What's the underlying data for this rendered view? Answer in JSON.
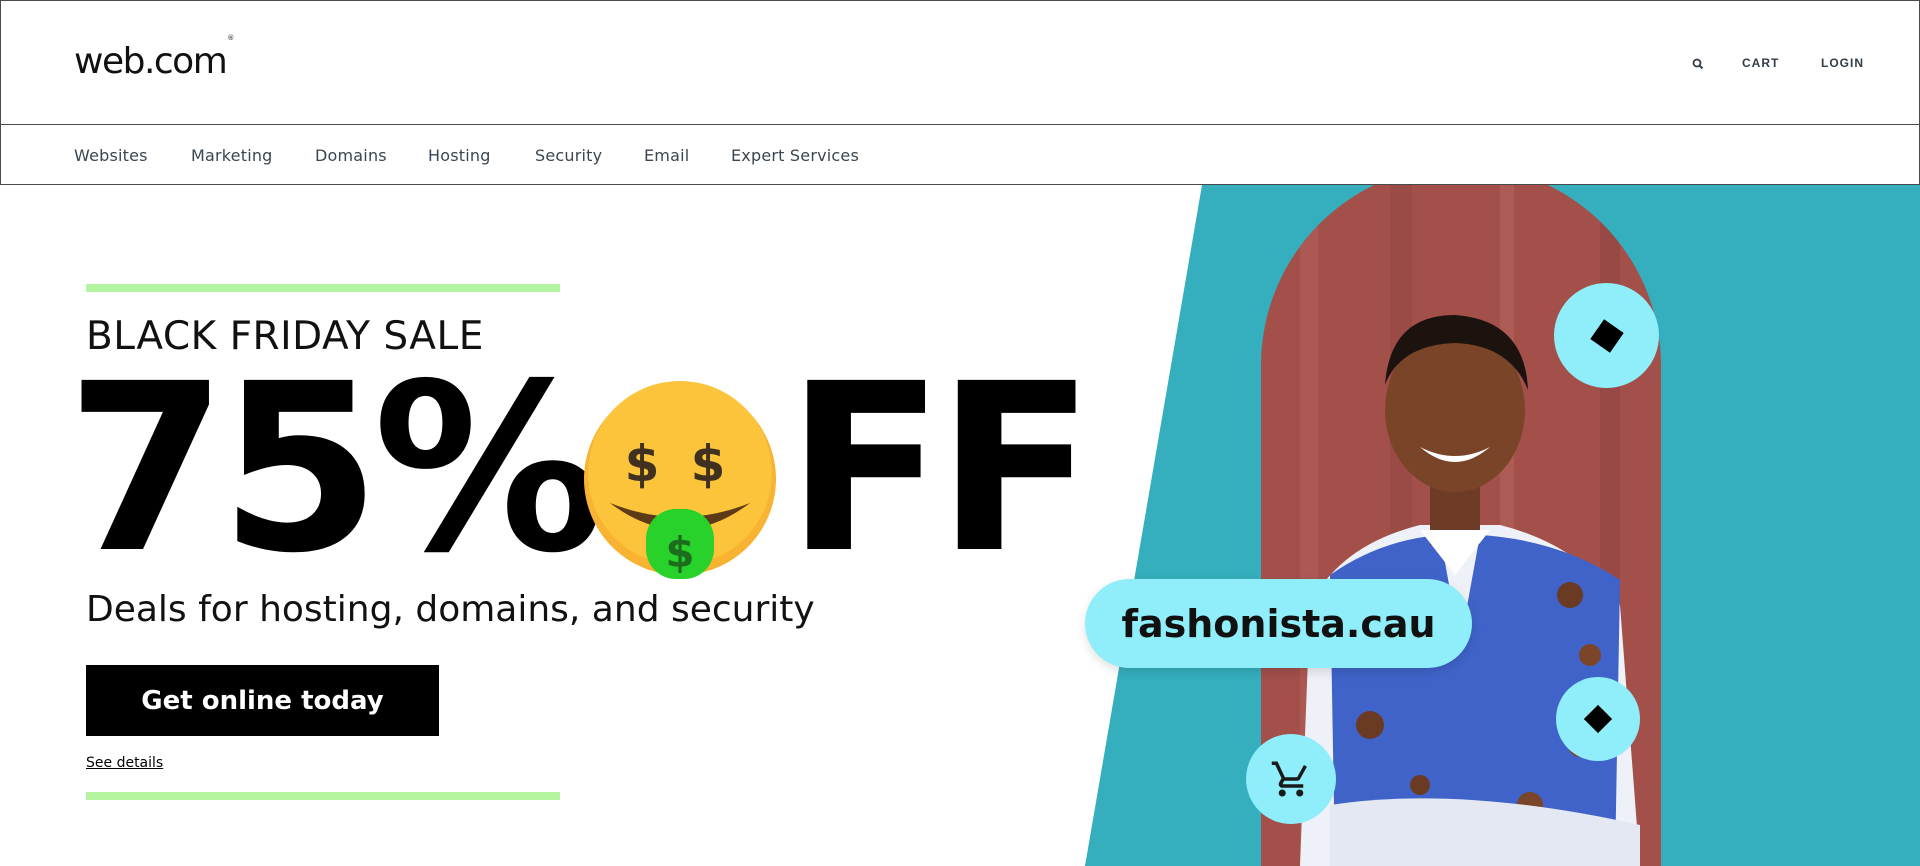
{
  "header": {
    "logo": "web.com",
    "logo_mark": "®",
    "search_icon": "search-icon",
    "cart_label": "CART",
    "login_label": "LOGIN"
  },
  "nav": {
    "items": [
      {
        "label": "Websites"
      },
      {
        "label": "Marketing"
      },
      {
        "label": "Domains"
      },
      {
        "label": "Hosting"
      },
      {
        "label": "Security"
      },
      {
        "label": "Email"
      },
      {
        "label": "Expert Services"
      }
    ]
  },
  "hero": {
    "kicker": "BLACK FRIDAY SALE",
    "headline_left": "75%",
    "headline_emoji": "money-mouth-face-emoji",
    "headline_right": "FF",
    "subhead": "Deals for hosting, domains, and security",
    "cta_label": "Get online today",
    "details_link": "See details",
    "domain_example": "fashonista.cau",
    "icons": [
      "diamond-icon",
      "diamond-icon",
      "cart-icon"
    ]
  },
  "colors": {
    "accent_green": "#b4f4a0",
    "teal_panel": "#35aebd",
    "light_cyan": "#8feef9",
    "cta_bg": "#000000",
    "nav_text": "#3a4651"
  }
}
